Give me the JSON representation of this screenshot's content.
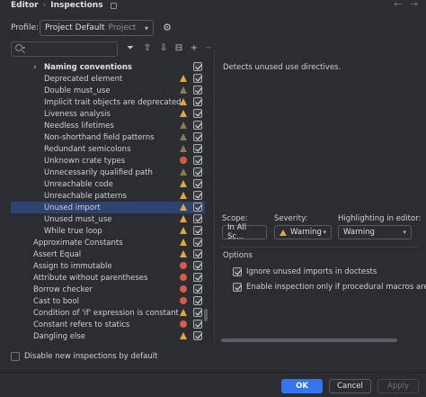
{
  "breadcrumb": {
    "root": "Editor",
    "separator": "›",
    "current": "Inspections"
  },
  "nav": {
    "back": "←",
    "forward": "→"
  },
  "profile": {
    "label": "Profile:",
    "value": "Project Default",
    "sublabel": "Project"
  },
  "search": {
    "placeholder": ""
  },
  "toolbar": {
    "filter": "⏷",
    "expand_all": "⇧",
    "collapse_all": "⇩",
    "reset": "⊟",
    "add": "+",
    "remove": "−"
  },
  "tree": [
    {
      "label": "Naming conventions",
      "group": true,
      "severity": "none"
    },
    {
      "label": "Deprecated element",
      "severity": "warn"
    },
    {
      "label": "Double must_use",
      "severity": "weak"
    },
    {
      "label": "Implicit trait objects are deprecated",
      "severity": "warn"
    },
    {
      "label": "Liveness analysis",
      "severity": "warn"
    },
    {
      "label": "Needless lifetimes",
      "severity": "weak"
    },
    {
      "label": "Non-shorthand field patterns",
      "severity": "weak"
    },
    {
      "label": "Redundant semicolons",
      "severity": "weak"
    },
    {
      "label": "Unknown crate types",
      "severity": "err"
    },
    {
      "label": "Unnecessarily qualified path",
      "severity": "weak"
    },
    {
      "label": "Unreachable code",
      "severity": "warn"
    },
    {
      "label": "Unreachable patterns",
      "severity": "warn"
    },
    {
      "label": "Unused import",
      "severity": "warn",
      "selected": true
    },
    {
      "label": "Unused must_use",
      "severity": "warn"
    },
    {
      "label": "While true loop",
      "severity": "warn"
    },
    {
      "label": "Approximate Constants",
      "severity": "warn",
      "top": true
    },
    {
      "label": "Assert Equal",
      "severity": "warn",
      "top": true
    },
    {
      "label": "Assign to immutable",
      "severity": "err",
      "top": true
    },
    {
      "label": "Attribute without parentheses",
      "severity": "err",
      "top": true
    },
    {
      "label": "Borrow checker",
      "severity": "err",
      "top": true
    },
    {
      "label": "Cast to bool",
      "severity": "err",
      "top": true
    },
    {
      "label": "Condition of 'if' expression is constant",
      "severity": "warn",
      "top": true
    },
    {
      "label": "Constant refers to statics",
      "severity": "err",
      "top": true
    },
    {
      "label": "Dangling else",
      "severity": "warn",
      "top": true
    }
  ],
  "description": "Detects unused use directives.",
  "scope": {
    "label": "Scope:",
    "value": "In All Sc..."
  },
  "severity": {
    "label": "Severity:",
    "value": "Warning"
  },
  "highlighting": {
    "label": "Highlighting in editor:",
    "value": "Warning"
  },
  "options": {
    "title": "Options",
    "items": [
      {
        "label": "Ignore unused imports in doctests",
        "checked": true
      },
      {
        "label": "Enable inspection only if procedural macros are en",
        "checked": true
      }
    ]
  },
  "footer": {
    "disable_new": "Disable new inspections by default",
    "ok": "OK",
    "cancel": "Cancel",
    "apply": "Apply"
  },
  "colors": {
    "accent": "#3574f0",
    "warning": "#e0a93a",
    "error": "#d75a4a",
    "selection": "#2e436e",
    "background": "#2b2d30"
  }
}
